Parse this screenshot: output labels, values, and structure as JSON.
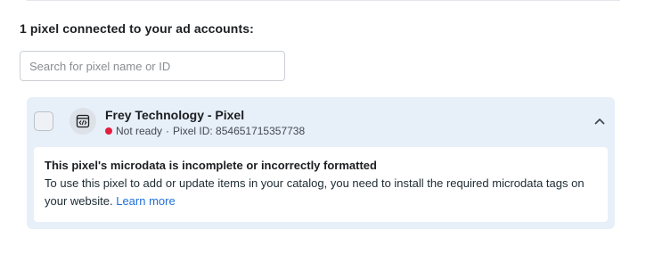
{
  "heading": "1 pixel connected to your ad accounts:",
  "search": {
    "placeholder": "Search for pixel name or ID",
    "value": ""
  },
  "pixel": {
    "name": "Frey Technology - Pixel",
    "status": "Not ready",
    "separator": "·",
    "id_text": "Pixel ID: 854651715357738",
    "icon": "code-window-icon",
    "status_color": "#e41e3f",
    "expanded": true
  },
  "notice": {
    "title": "This pixel's microdata is incomplete or incorrectly formatted",
    "body": "To use this pixel to add or update items in your catalog, you need to install the required microdata tags on your website.",
    "link": "Learn more",
    "link_color": "#216fdb"
  }
}
